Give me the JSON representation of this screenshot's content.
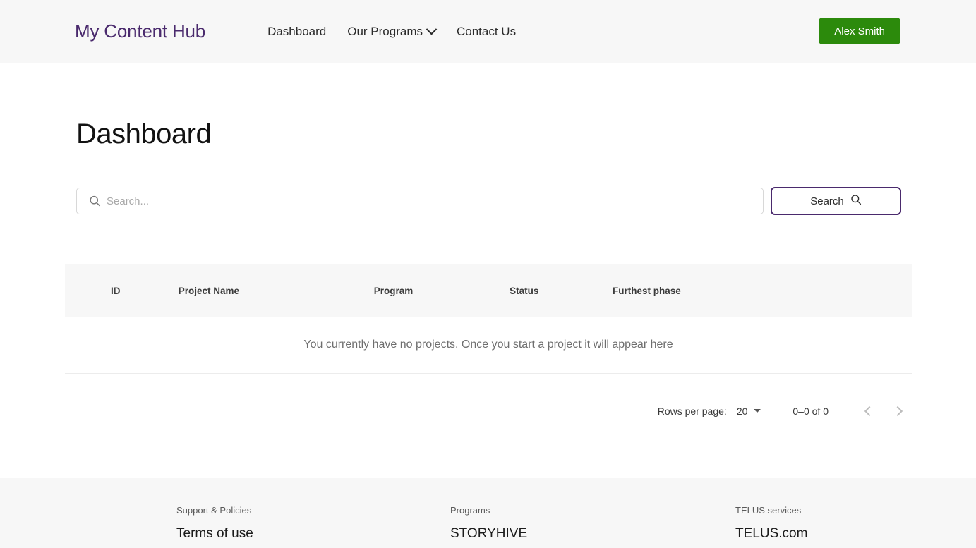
{
  "header": {
    "brand": "My Content Hub",
    "nav": [
      {
        "label": "Dashboard",
        "has_dropdown": false
      },
      {
        "label": "Our Programs",
        "has_dropdown": true
      },
      {
        "label": "Contact Us",
        "has_dropdown": false
      }
    ],
    "user_button": "Alex Smith",
    "accent_green": "#2c8a0c",
    "brand_purple": "#4a2a6d"
  },
  "main": {
    "page_title": "Dashboard",
    "search": {
      "placeholder": "Search...",
      "value": "",
      "icon": "search-icon",
      "button_label": "Search",
      "button_icon": "search-icon"
    },
    "table": {
      "columns": [
        "ID",
        "Project Name",
        "Program",
        "Status",
        "Furthest phase"
      ],
      "rows": [],
      "empty_message": "You currently have no projects. Once you start a project it will appear here"
    },
    "pagination": {
      "rows_per_page_label": "Rows per page:",
      "rows_per_page_value": "20",
      "range_label": "0–0 of 0",
      "prev_icon": "chevron-left-icon",
      "next_icon": "chevron-right-icon"
    }
  },
  "footer": {
    "columns": [
      {
        "heading": "Support & Policies",
        "link": "Terms of use"
      },
      {
        "heading": "Programs",
        "link": "STORYHIVE"
      },
      {
        "heading": "TELUS services",
        "link": "TELUS.com"
      }
    ]
  }
}
